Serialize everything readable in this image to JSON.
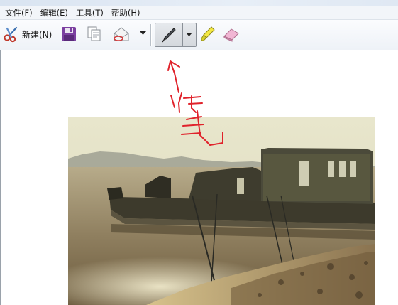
{
  "menu": {
    "items": [
      {
        "label": "文件(F)"
      },
      {
        "label": "编辑(E)"
      },
      {
        "label": "工具(T)"
      },
      {
        "label": "帮助(H)"
      }
    ]
  },
  "toolbar": {
    "new_label": "新建(N)",
    "buttons": [
      "scissors-icon",
      "save-icon",
      "copy-icon",
      "send-icon",
      "dropdown-arrow",
      "pen-icon",
      "pen-dropdown",
      "highlighter-icon",
      "eraser-icon"
    ]
  },
  "colors": {
    "ink": "#e0222b",
    "accent": "#7b3fa0"
  }
}
